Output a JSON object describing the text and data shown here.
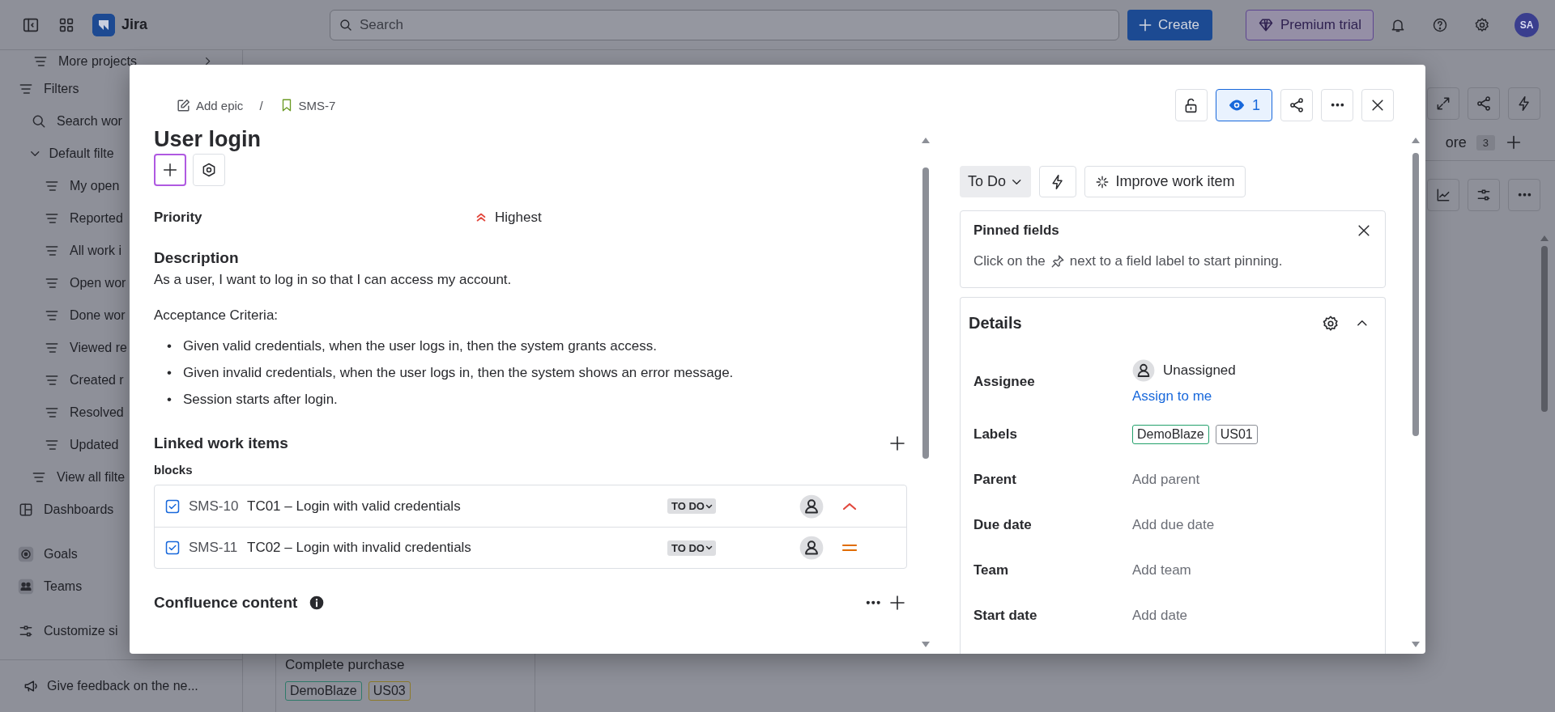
{
  "top_nav": {
    "app_name": "Jira",
    "search_placeholder": "Search",
    "create_button": "Create",
    "premium_button": "Premium trial",
    "avatar_initials": "SA"
  },
  "sidebar": {
    "more_projects": "More projects",
    "groups": [
      {
        "items": [
          {
            "label": "Filters",
            "kind": "filters",
            "children": [
              {
                "label": "Search wor",
                "kind": "search"
              },
              {
                "label": "Default filte",
                "kind": "folder",
                "expanded": true,
                "children": [
                  {
                    "label": "My open",
                    "kind": "filter"
                  },
                  {
                    "label": "Reported",
                    "kind": "filter"
                  },
                  {
                    "label": "All work i",
                    "kind": "filter"
                  },
                  {
                    "label": "Open wor",
                    "kind": "filter"
                  },
                  {
                    "label": "Done wor",
                    "kind": "filter"
                  },
                  {
                    "label": "Viewed re",
                    "kind": "filter"
                  },
                  {
                    "label": "Created r",
                    "kind": "filter"
                  },
                  {
                    "label": "Resolved",
                    "kind": "filter"
                  },
                  {
                    "label": "Updated",
                    "kind": "filter"
                  }
                ]
              },
              {
                "label": "View all filte",
                "kind": "filter"
              }
            ]
          },
          {
            "label": "Dashboards",
            "kind": "dashboards"
          }
        ]
      },
      {
        "items": [
          {
            "label": "Goals",
            "kind": "goals"
          },
          {
            "label": "Teams",
            "kind": "teams"
          }
        ]
      },
      {
        "items": [
          {
            "label": "Customize si",
            "kind": "customize"
          }
        ]
      }
    ],
    "feedback": "Give feedback on the ne..."
  },
  "board": {
    "tab_label": "ore",
    "tab_count": "3",
    "card": {
      "title": "Complete purchase",
      "labels": [
        {
          "text": "DemoBlaze",
          "color": "#2f7a6a"
        },
        {
          "text": "US03",
          "color": "#8c7a2a"
        }
      ]
    }
  },
  "issue": {
    "breadcrumb": [
      {
        "label": "Add epic",
        "kind": "add-epic"
      },
      {
        "label": "SMS-7",
        "kind": "story"
      }
    ],
    "breadcrumb_separator": "/",
    "watchers": "1",
    "watching": true,
    "title": "User login",
    "add_button_focused": true,
    "priority": {
      "label": "Priority",
      "value": "Highest",
      "kind": "highest"
    },
    "description": {
      "heading": "Description",
      "paragraphs": [
        "As a user, I want to log in so that I can access my account.",
        "Acceptance Criteria:"
      ],
      "bullet_marker": "•",
      "bullets": [
        "Given valid credentials, when the user logs in, then the system grants access.",
        "Given invalid credentials, when the user logs in, then the system shows an error message.",
        "Session starts after login."
      ]
    },
    "linked": {
      "heading": "Linked work items",
      "relation": "blocks",
      "items": [
        {
          "key": "SMS-10",
          "summary": "TC01 – Login with valid credentials",
          "status": "TO DO",
          "kind": "high"
        },
        {
          "key": "SMS-11",
          "summary": "TC02 – Login with invalid credentials",
          "status": "TO DO",
          "kind": "medium"
        }
      ]
    },
    "confluence_heading": "Confluence content",
    "status_button": "To Do",
    "improve_button": "Improve work item",
    "pinned": {
      "title": "Pinned fields",
      "text_before": "Click on the",
      "text_after": "next to a field label to start pinning."
    },
    "details": {
      "heading": "Details",
      "expanded": true,
      "fields": [
        {
          "label": "Assignee",
          "kind": "assignee",
          "value": "Unassigned",
          "action": "Assign to me"
        },
        {
          "label": "Labels",
          "kind": "labels",
          "labels": [
            {
              "text": "DemoBlaze",
              "color": "#22a06b"
            },
            {
              "text": "US01",
              "color": "#8c8f97"
            }
          ]
        },
        {
          "label": "Parent",
          "kind": "empty",
          "value": "Add parent"
        },
        {
          "label": "Due date",
          "kind": "empty",
          "value": "Add due date"
        },
        {
          "label": "Team",
          "kind": "empty",
          "value": "Add team"
        },
        {
          "label": "Start date",
          "kind": "empty",
          "value": "Add date"
        }
      ]
    }
  }
}
